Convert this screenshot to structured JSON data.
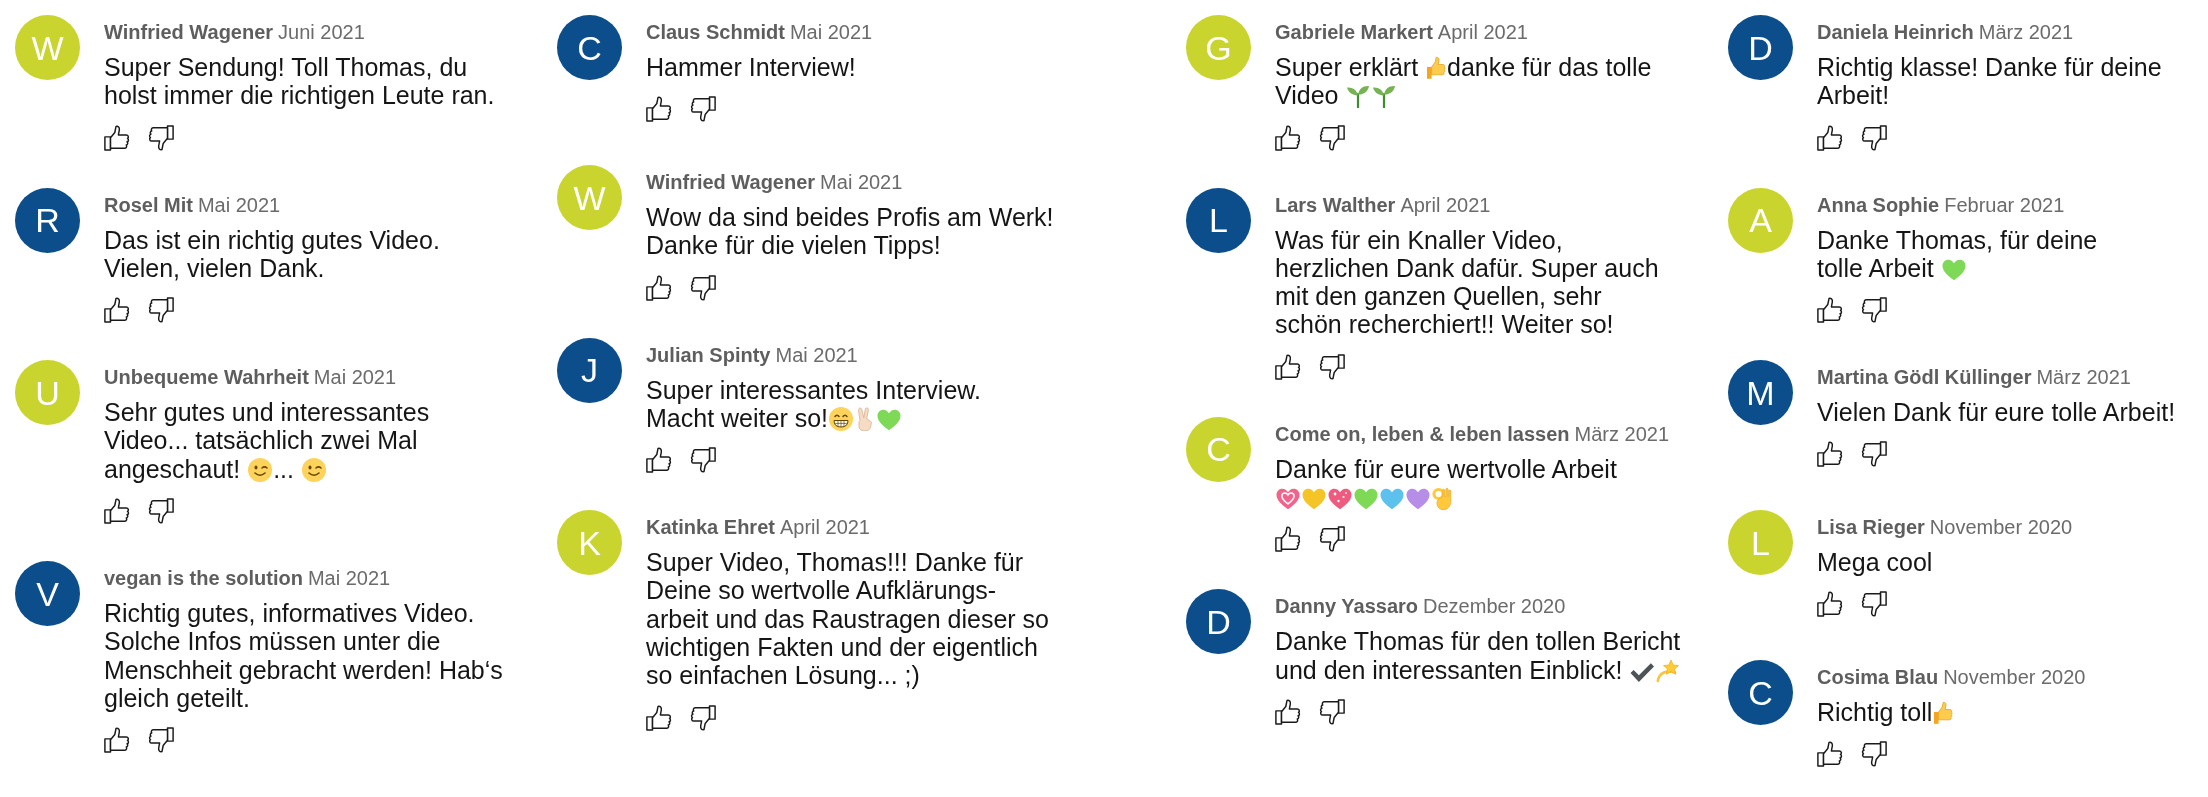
{
  "columns": [
    {
      "comments": [
        {
          "avatar": {
            "initial": "W",
            "color": "#c9d52e"
          },
          "author": "Winfried Wagener",
          "date": "Juni 2021",
          "body": [
            {
              "kind": "text",
              "text": "Super Sendung! Toll Thomas, du\nholst immer die richtigen Leute ran."
            }
          ]
        },
        {
          "avatar": {
            "initial": "R",
            "color": "#0b4e8b"
          },
          "author": "Rosel Mit",
          "date": "Mai 2021",
          "body": [
            {
              "kind": "text",
              "text": "Das ist ein richtig gutes Video.\nVielen, vielen Dank."
            }
          ]
        },
        {
          "avatar": {
            "initial": "U",
            "color": "#c9d52e"
          },
          "author": "Unbequeme Wahrheit",
          "date": "Mai 2021",
          "body": [
            {
              "kind": "text",
              "text": "Sehr gutes und interessantes\nVideo... tatsächlich zwei Mal\nangeschaut! "
            },
            {
              "kind": "wink"
            },
            {
              "kind": "text",
              "text": "... "
            },
            {
              "kind": "wink"
            }
          ]
        },
        {
          "avatar": {
            "initial": "V",
            "color": "#0b4e8b"
          },
          "author": "vegan is the solution",
          "date": "Mai 2021",
          "body": [
            {
              "kind": "text",
              "text": "Richtig gutes, informatives Video.\nSolche Infos müssen unter die\nMenschheit gebracht werden! Hab‘s\ngleich geteilt."
            }
          ]
        }
      ]
    },
    {
      "comments": [
        {
          "avatar": {
            "initial": "C",
            "color": "#0b4e8b"
          },
          "author": "Claus Schmidt",
          "date": "Mai 2021",
          "body": [
            {
              "kind": "text",
              "text": "Hammer Interview!"
            }
          ]
        },
        {
          "avatar": {
            "initial": "W",
            "color": "#c9d52e"
          },
          "author": "Winfried Wagener",
          "date": "Mai 2021",
          "body": [
            {
              "kind": "text",
              "text": "Wow da sind beides Profis am Werk!\nDanke für die vielen Tipps!"
            }
          ]
        },
        {
          "avatar": {
            "initial": "J",
            "color": "#0b4e8b"
          },
          "author": "Julian Spinty",
          "date": "Mai 2021",
          "body": [
            {
              "kind": "text",
              "text": "Super interessantes Interview.\nMacht weiter so!"
            },
            {
              "kind": "grin"
            },
            {
              "kind": "victory"
            },
            {
              "kind": "heart",
              "color": "#7ed957"
            }
          ]
        },
        {
          "avatar": {
            "initial": "K",
            "color": "#c9d52e"
          },
          "author": "Katinka Ehret",
          "date": "April 2021",
          "body": [
            {
              "kind": "text",
              "text": "Super Video, Thomas!!! Danke für\nDeine so wertvolle Aufklärungs-\narbeit und das Raustragen dieser so\nwichtigen Fakten und der eigentlich\nso einfachen Lösung... ;)"
            }
          ]
        }
      ]
    },
    {
      "comments": [
        {
          "avatar": {
            "initial": "G",
            "color": "#c9d52e"
          },
          "author": "Gabriele Markert",
          "date": "April 2021",
          "body": [
            {
              "kind": "text",
              "text": "Super erklärt "
            },
            {
              "kind": "thumbsup"
            },
            {
              "kind": "text",
              "text": "danke für das tolle\nVideo "
            },
            {
              "kind": "seedling"
            },
            {
              "kind": "seedling"
            }
          ]
        },
        {
          "avatar": {
            "initial": "L",
            "color": "#0b4e8b"
          },
          "author": "Lars Walther",
          "date": "April 2021",
          "body": [
            {
              "kind": "text",
              "text": "Was für ein Knaller Video,\nherzlichen Dank dafür. Super auch\nmit den ganzen Quellen, sehr\nschön recherchiert!! Weiter so!"
            }
          ]
        },
        {
          "avatar": {
            "initial": "C",
            "color": "#c9d52e"
          },
          "author": "Come on, leben & leben lassen",
          "date": "März 2021",
          "body": [
            {
              "kind": "text",
              "text": "Danke für eure wertvolle Arbeit\n"
            },
            {
              "kind": "growingheart",
              "color": "#f2628a"
            },
            {
              "kind": "heart",
              "color": "#f5c527"
            },
            {
              "kind": "sparkleheart",
              "color": "#ef5a7f"
            },
            {
              "kind": "heart",
              "color": "#7ed957"
            },
            {
              "kind": "heart",
              "color": "#5dc1ee"
            },
            {
              "kind": "heart",
              "color": "#b68ee8"
            },
            {
              "kind": "okhand"
            }
          ]
        },
        {
          "avatar": {
            "initial": "D",
            "color": "#0b4e8b"
          },
          "author": "Danny Yassaro",
          "date": "Dezember 2020",
          "body": [
            {
              "kind": "text",
              "text": "Danke Thomas für den tollen Bericht\nund den interessanten Einblick! "
            },
            {
              "kind": "check"
            },
            {
              "kind": "dizzy"
            }
          ]
        }
      ]
    },
    {
      "comments": [
        {
          "avatar": {
            "initial": "D",
            "color": "#0b4e8b"
          },
          "author": "Daniela Heinrich",
          "date": "März 2021",
          "body": [
            {
              "kind": "text",
              "text": "Richtig klasse! Danke für deine\nArbeit!"
            }
          ]
        },
        {
          "avatar": {
            "initial": "A",
            "color": "#c9d52e"
          },
          "author": "Anna Sophie",
          "date": "Februar 2021",
          "body": [
            {
              "kind": "text",
              "text": "Danke Thomas, für deine\ntolle Arbeit "
            },
            {
              "kind": "heart",
              "color": "#7ed957"
            }
          ]
        },
        {
          "avatar": {
            "initial": "M",
            "color": "#0b4e8b"
          },
          "author": "Martina Gödl Küllinger",
          "date": "März 2021",
          "body": [
            {
              "kind": "text",
              "text": "Vielen Dank für eure tolle Arbeit!"
            }
          ]
        },
        {
          "avatar": {
            "initial": "L",
            "color": "#c9d52e"
          },
          "author": "Lisa Rieger",
          "date": "November 2020",
          "body": [
            {
              "kind": "text",
              "text": "Mega cool"
            }
          ]
        },
        {
          "avatar": {
            "initial": "C",
            "color": "#0b4e8b"
          },
          "author": "Cosima Blau",
          "date": "November 2020",
          "body": [
            {
              "kind": "text",
              "text": "Richtig toll"
            },
            {
              "kind": "thumbsup"
            }
          ]
        }
      ]
    }
  ]
}
